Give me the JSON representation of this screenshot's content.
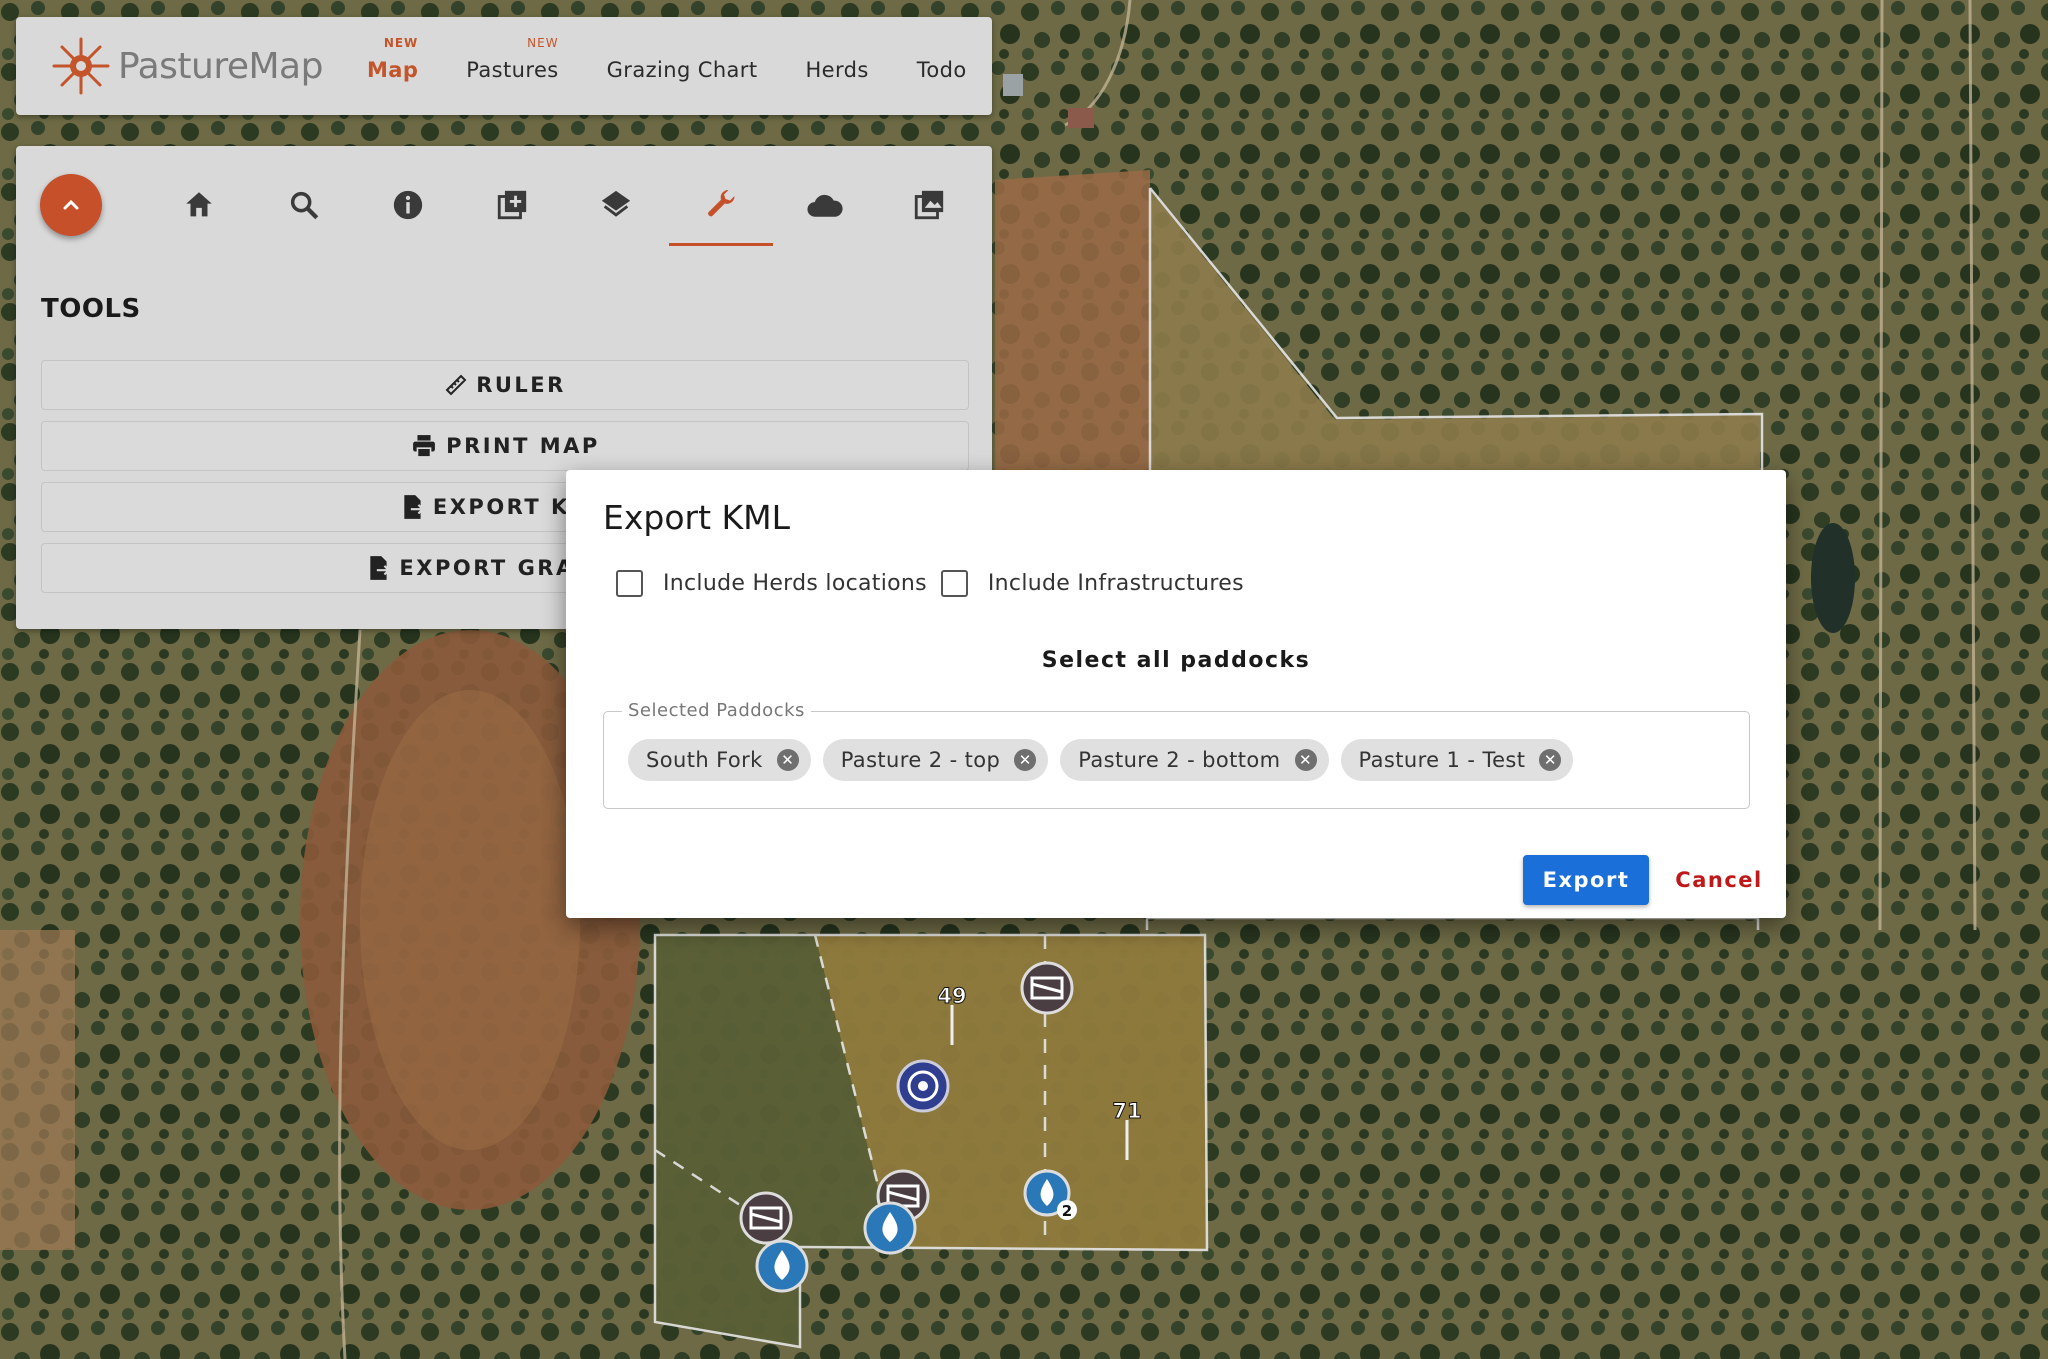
{
  "nav": {
    "brand": "PastureMap",
    "items": [
      {
        "label": "Map",
        "badge": "NEW"
      },
      {
        "label": "Pastures",
        "badge": "NEW"
      },
      {
        "label": "Grazing Chart"
      },
      {
        "label": "Herds"
      },
      {
        "label": "Todo"
      }
    ],
    "accent_color": "#c4542a"
  },
  "toolbar": {
    "icons": [
      "chevron-up-icon",
      "home-icon",
      "search-icon",
      "info-icon",
      "add-layer-icon",
      "layers-icon",
      "wrench-icon",
      "cloud-icon",
      "image-icon"
    ],
    "active": "wrench-icon"
  },
  "tools": {
    "title": "TOOLS",
    "buttons": [
      "RULER",
      "PRINT MAP",
      "EXPORT KML",
      "EXPORT GRAZING"
    ]
  },
  "dialog": {
    "title": "Export KML",
    "include_herds": "Include Herds locations",
    "include_infra": "Include Infrastructures",
    "select_all": "Select all paddocks",
    "selected_label": "Selected Paddocks",
    "paddocks": [
      "South Fork",
      "Pasture 2 - top",
      "Pasture 2 - bottom",
      "Pasture 1 - Test"
    ],
    "export": "Export",
    "cancel": "Cancel",
    "export_color": "#1a6fd8",
    "cancel_color": "#c01818"
  },
  "map_labels": {
    "marker_49": "49",
    "marker_71": "71",
    "water_count": "2"
  }
}
